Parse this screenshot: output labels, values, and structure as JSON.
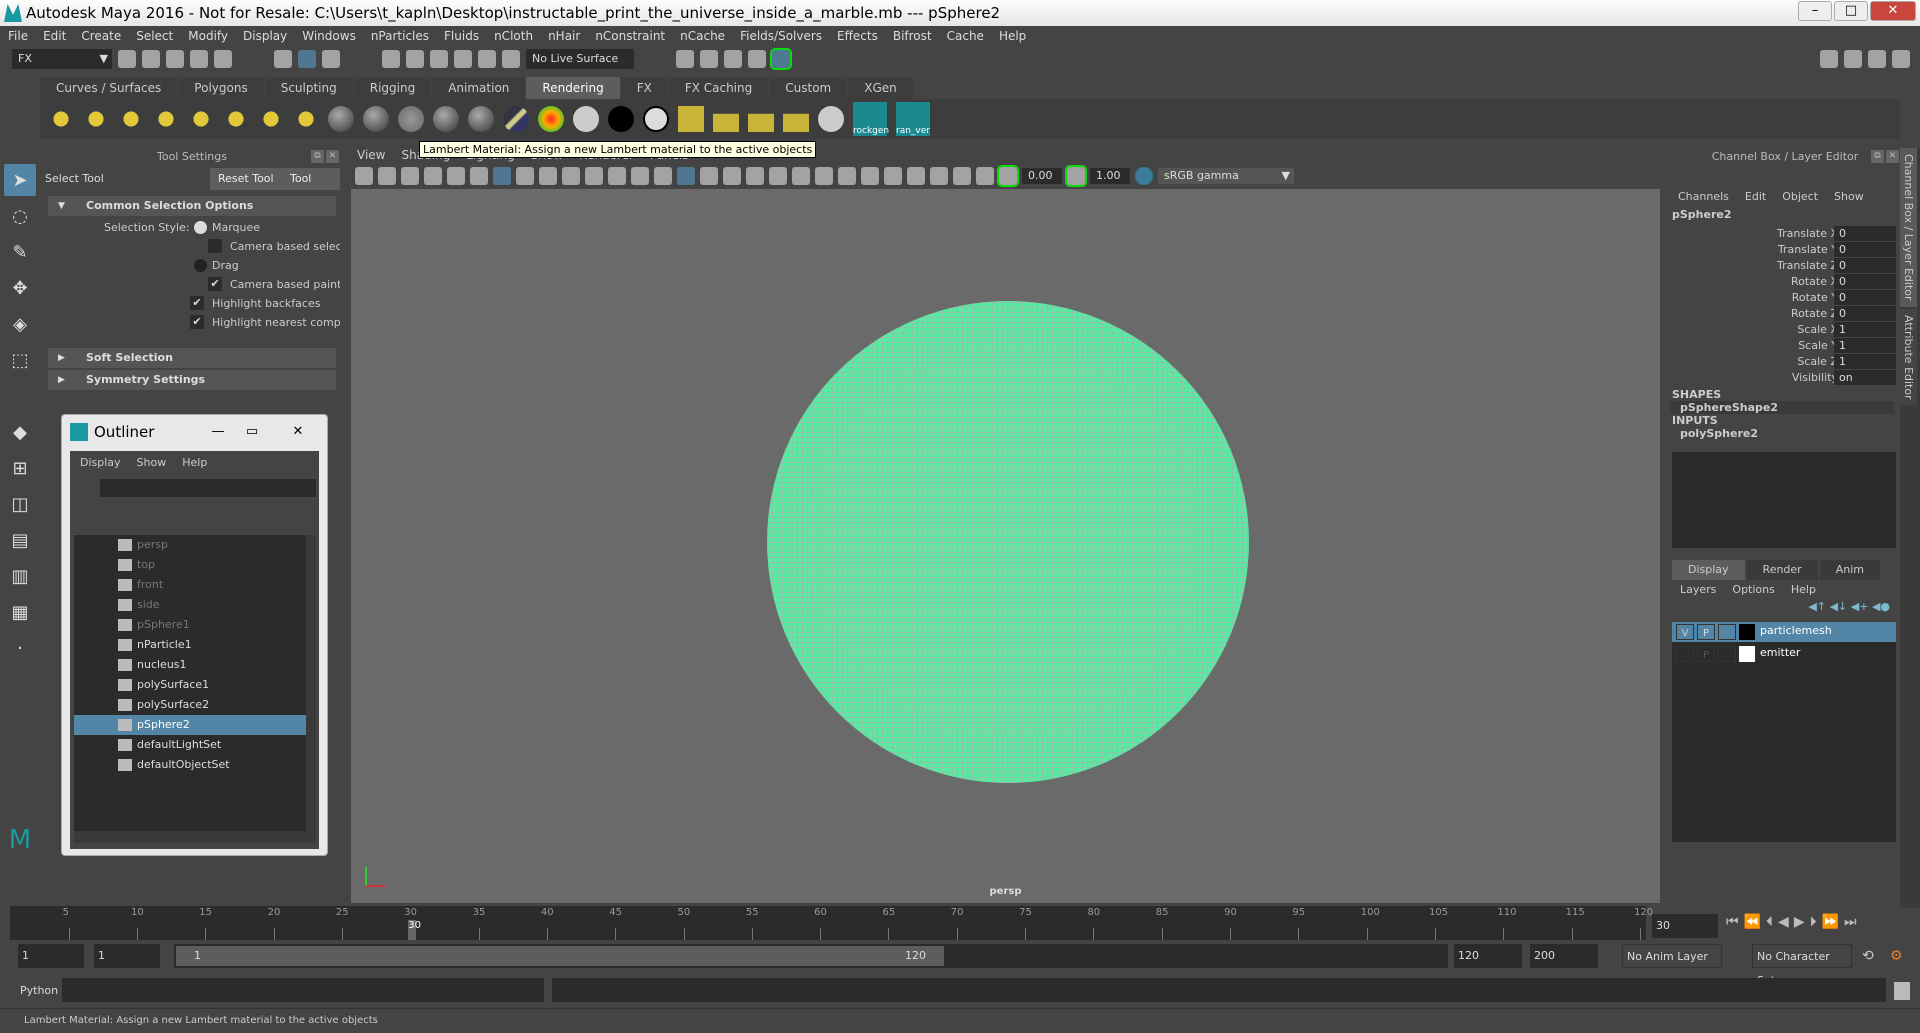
{
  "title": "Autodesk Maya 2016 - Not for Resale: C:\\Users\\t_kapln\\Desktop\\instructable_print_the_universe_inside_a_marble.mb   ---   pSphere2",
  "menu": [
    "File",
    "Edit",
    "Create",
    "Select",
    "Modify",
    "Display",
    "Windows",
    "nParticles",
    "Fluids",
    "nCloth",
    "nHair",
    "nConstraint",
    "nCache",
    "Fields/Solvers",
    "Effects",
    "Bifrost",
    "Cache",
    "Help"
  ],
  "status": {
    "menuset": "FX",
    "live_surface": "No Live Surface"
  },
  "shelf": {
    "tabs": [
      "Curves / Surfaces",
      "Polygons",
      "Sculpting",
      "Rigging",
      "Animation",
      "Rendering",
      "FX",
      "FX Caching",
      "Custom",
      "XGen"
    ],
    "active_tab": "Rendering",
    "custom_buttons": [
      "rockgen",
      "ran_ver"
    ]
  },
  "tooltip": "Lambert Material: Assign a new Lambert material to the active objects",
  "tool_settings": {
    "header": "Tool Settings",
    "tool_name": "Select Tool",
    "reset": "Reset Tool",
    "help": "Tool Help",
    "sections": {
      "common": "Common Selection Options",
      "soft": "Soft Selection",
      "symmetry": "Symmetry Settings"
    },
    "selection_style_label": "Selection Style:",
    "marquee": "Marquee",
    "camera_based_selection": "Camera based selection",
    "drag": "Drag",
    "camera_based_paint": "Camera based paint selection",
    "highlight_backfaces": "Highlight backfaces",
    "highlight_nearest": "Highlight nearest component"
  },
  "outliner": {
    "title": "Outliner",
    "menu": [
      "Display",
      "Show",
      "Help"
    ],
    "items": [
      {
        "label": "persp",
        "dim": true
      },
      {
        "label": "top",
        "dim": true
      },
      {
        "label": "front",
        "dim": true
      },
      {
        "label": "side",
        "dim": true
      },
      {
        "label": "pSphere1",
        "dim": true
      },
      {
        "label": "nParticle1"
      },
      {
        "label": "nucleus1"
      },
      {
        "label": "polySurface1"
      },
      {
        "label": "polySurface2"
      },
      {
        "label": "pSphere2",
        "selected": true
      },
      {
        "label": "defaultLightSet"
      },
      {
        "label": "defaultObjectSet"
      }
    ]
  },
  "viewport": {
    "menu": [
      "View",
      "Shading",
      "Lighting",
      "Show",
      "Renderer",
      "Panels"
    ],
    "exposure": "0.00",
    "gamma": "1.00",
    "color_space": "sRGB gamma",
    "camera": "persp",
    "object_color": "#5ee8a6"
  },
  "channel_box": {
    "header": "Channel Box / Layer Editor",
    "menu": [
      "Channels",
      "Edit",
      "Object",
      "Show"
    ],
    "object": "pSphere2",
    "attrs": [
      {
        "name": "Translate X",
        "value": "0"
      },
      {
        "name": "Translate Y",
        "value": "0"
      },
      {
        "name": "Translate Z",
        "value": "0"
      },
      {
        "name": "Rotate X",
        "value": "0"
      },
      {
        "name": "Rotate Y",
        "value": "0"
      },
      {
        "name": "Rotate Z",
        "value": "0"
      },
      {
        "name": "Scale X",
        "value": "1"
      },
      {
        "name": "Scale Y",
        "value": "1"
      },
      {
        "name": "Scale Z",
        "value": "1"
      },
      {
        "name": "Visibility",
        "value": "on"
      }
    ],
    "shapes_label": "SHAPES",
    "shape": "pSphereShape2",
    "inputs_label": "INPUTS",
    "input": "polySphere2"
  },
  "layer_editor": {
    "tabs": [
      "Display",
      "Render",
      "Anim"
    ],
    "menu": [
      "Layers",
      "Options",
      "Help"
    ],
    "layers": [
      {
        "v": "V",
        "p": "P",
        "name": "particlemesh",
        "color": "#000000",
        "selected": true
      },
      {
        "v": "",
        "p": "P",
        "name": "emitter",
        "color": "#ffffff"
      }
    ]
  },
  "side_tabs": [
    "Channel Box / Layer Editor",
    "Attribute Editor"
  ],
  "timeline": {
    "ticks": [
      5,
      10,
      15,
      20,
      25,
      30,
      35,
      40,
      45,
      50,
      55,
      60,
      65,
      70,
      75,
      80,
      85,
      90,
      95,
      100,
      105,
      110,
      115,
      120
    ],
    "start": 1,
    "end": 120,
    "current": "30"
  },
  "range": {
    "start": "1",
    "playback_start": "1",
    "slider_start": "1",
    "slider_end": "120",
    "playback_end": "120",
    "end": "200",
    "anim_layer": "No Anim Layer",
    "character_set": "No Character Set"
  },
  "command": {
    "language": "Python"
  },
  "help_line": "Lambert Material: Assign a new Lambert material to the active objects"
}
